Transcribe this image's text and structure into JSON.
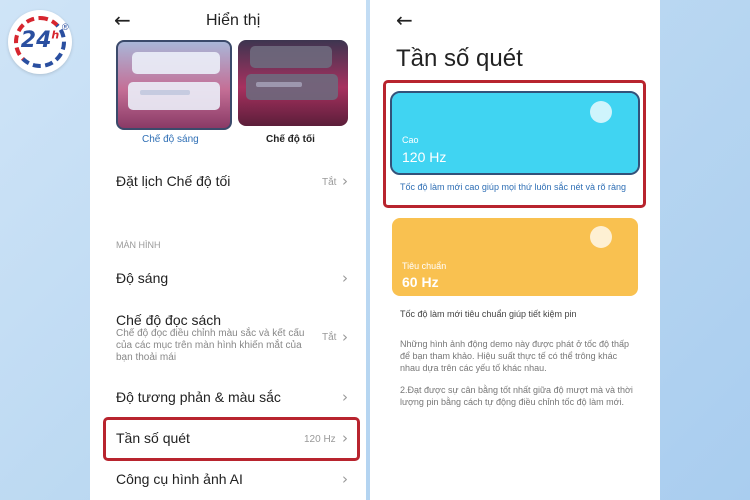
{
  "logo": {
    "text": "24",
    "sup": "h",
    "reg": "®"
  },
  "left_panel": {
    "back_icon": "arrow-left-icon",
    "title": "Hiển thị",
    "modes": {
      "light_label": "Chế độ sáng",
      "dark_label": "Chế độ tối"
    },
    "schedule": {
      "title": "Đặt lịch Chế độ tối",
      "value": "Tắt"
    },
    "section_label": "MÀN HÌNH",
    "brightness": {
      "title": "Độ sáng"
    },
    "reading": {
      "title": "Chế độ đọc sách",
      "desc": "Chế độ đọc điều chỉnh màu sắc và kết cấu của các mục trên màn hình khiến mắt của bạn thoải mái",
      "value": "Tắt"
    },
    "contrast": {
      "title": "Độ tương phản & màu sắc"
    },
    "refresh": {
      "title": "Tần số quét",
      "value": "120 Hz"
    },
    "ai_tools": {
      "title": "Công cụ hình ảnh AI"
    },
    "chevron": "›"
  },
  "right_panel": {
    "back_icon": "arrow-left-icon",
    "title": "Tần số quét",
    "high": {
      "label": "Cao",
      "value": "120 Hz",
      "desc": "Tốc độ làm mới cao giúp mọi thứ luôn sắc nét và rõ ràng"
    },
    "standard": {
      "label": "Tiêu chuẩn",
      "value": "60 Hz",
      "desc": "Tốc độ làm mới tiêu chuẩn giúp tiết kiệm pin"
    },
    "note1": "Những hình ảnh động demo này được phát ở tốc độ thấp để bạn tham khảo. Hiệu suất thực tế có thể trông khác nhau dựa trên các yếu tố khác nhau.",
    "note2": "2.Đạt được sự cân bằng tốt nhất giữa độ mượt mà và thời lượng pin bằng cách tự động điều chỉnh tốc độ làm mới."
  },
  "colors": {
    "high_card": "#40d4f2",
    "standard_card": "#f9c150",
    "highlight": "#b8242e",
    "accent_blue": "#2f6fb5"
  }
}
